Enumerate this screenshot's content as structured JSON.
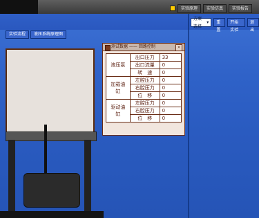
{
  "top_tabs": [
    "实验原理",
    "实验仿真",
    "实验报告"
  ],
  "tool_bar": {
    "select_value": "方案选择",
    "buttons": [
      "重置",
      "开始实验",
      "退出"
    ]
  },
  "left_tabs": [
    "实验流程",
    "液压系统原理图"
  ],
  "dialog": {
    "title": "测试数据 —— 回路控制",
    "rows": [
      {
        "group": "液压泵",
        "items": [
          {
            "label": "出口压力",
            "value": "33"
          },
          {
            "label": "出口流量",
            "value": "0"
          },
          {
            "label": "转　速",
            "value": "0"
          }
        ]
      },
      {
        "group": "加载油缸",
        "items": [
          {
            "label": "左腔压力",
            "value": "0"
          },
          {
            "label": "右腔压力",
            "value": "0"
          },
          {
            "label": "位　移",
            "value": "0"
          }
        ]
      },
      {
        "group": "驱动油缸",
        "items": [
          {
            "label": "左腔压力",
            "value": "0"
          },
          {
            "label": "右腔压力",
            "value": "0"
          },
          {
            "label": "位　移",
            "value": "0"
          }
        ]
      }
    ]
  },
  "colors": {
    "background_blue": "#2f62c8",
    "dialog_border": "#6a2d16",
    "dialog_bg": "#f1e6de"
  },
  "icons": [
    "dropdown-caret-icon",
    "close-icon",
    "app-icon"
  ]
}
